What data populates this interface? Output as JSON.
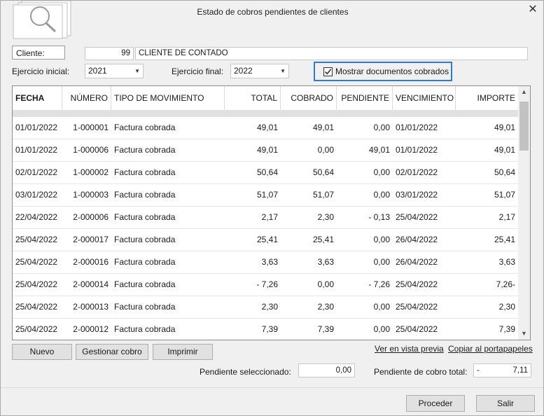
{
  "window": {
    "title": "Estado de cobros pendientes de clientes",
    "close_glyph": "✕"
  },
  "cliente": {
    "label": "Cliente:",
    "code": "99",
    "name": "CLIENTE DE CONTADO"
  },
  "ejercicio_inicial": {
    "label": "Ejercicio inicial:",
    "value": "2021",
    "arrow": "▼"
  },
  "ejercicio_final": {
    "label": "Ejercicio final:",
    "value": "2022",
    "arrow": "▼"
  },
  "mostrar": {
    "label": "Mostrar documentos cobrados",
    "checked": true,
    "check_glyph": "✓"
  },
  "grid": {
    "headers": [
      "FECHA",
      "NÚMERO",
      "TIPO DE MOVIMIENTO",
      "TOTAL",
      "COBRADO",
      "PENDIENTE",
      "VENCIMIENTO",
      "IMPORTE"
    ],
    "rows": [
      [
        "01/01/2022",
        "1-000001",
        "Factura cobrada",
        "49,01",
        "49,01",
        "0,00",
        "01/01/2022",
        "49,01"
      ],
      [
        "01/01/2022",
        "1-000006",
        "Factura cobrada",
        "49,01",
        "0,00",
        "49,01",
        "01/01/2022",
        "49,01"
      ],
      [
        "02/01/2022",
        "1-000002",
        "Factura cobrada",
        "50,64",
        "50,64",
        "0,00",
        "02/01/2022",
        "50,64"
      ],
      [
        "03/01/2022",
        "1-000003",
        "Factura cobrada",
        "51,07",
        "51,07",
        "0,00",
        "03/01/2022",
        "51,07"
      ],
      [
        "22/04/2022",
        "2-000006",
        "Factura cobrada",
        "2,17",
        "2,30",
        "- 0,13",
        "25/04/2022",
        "2,17"
      ],
      [
        "25/04/2022",
        "2-000017",
        "Factura cobrada",
        "25,41",
        "25,41",
        "0,00",
        "26/04/2022",
        "25,41"
      ],
      [
        "25/04/2022",
        "2-000016",
        "Factura cobrada",
        "3,63",
        "3,63",
        "0,00",
        "26/04/2022",
        "3,63"
      ],
      [
        "25/04/2022",
        "2-000014",
        "Factura cobrada",
        "- 7,26",
        "0,00",
        "- 7,26",
        "25/04/2022",
        "7,26-"
      ],
      [
        "25/04/2022",
        "2-000013",
        "Factura cobrada",
        "2,30",
        "2,30",
        "0,00",
        "25/04/2022",
        "2,30"
      ],
      [
        "25/04/2022",
        "2-000012",
        "Factura cobrada",
        "7,39",
        "7,39",
        "0,00",
        "25/04/2022",
        "7,39"
      ]
    ],
    "scroll_up": "▲",
    "scroll_down": "▼"
  },
  "actions": {
    "nuevo": "Nuevo",
    "gestionar": "Gestionar cobro",
    "imprimir": "Imprimir",
    "vista_previa": "Ver en vista previa",
    "portapapeles": "Copiar al portapapeles"
  },
  "totals": {
    "pendiente_sel_label": "Pendiente seleccionado:",
    "pendiente_sel_value": "0,00",
    "pendiente_total_label": "Pendiente de cobro total:",
    "pendiente_total_sign": "-",
    "pendiente_total_value": "7,11"
  },
  "footer": {
    "proceder": "Proceder",
    "salir": "Salir"
  }
}
